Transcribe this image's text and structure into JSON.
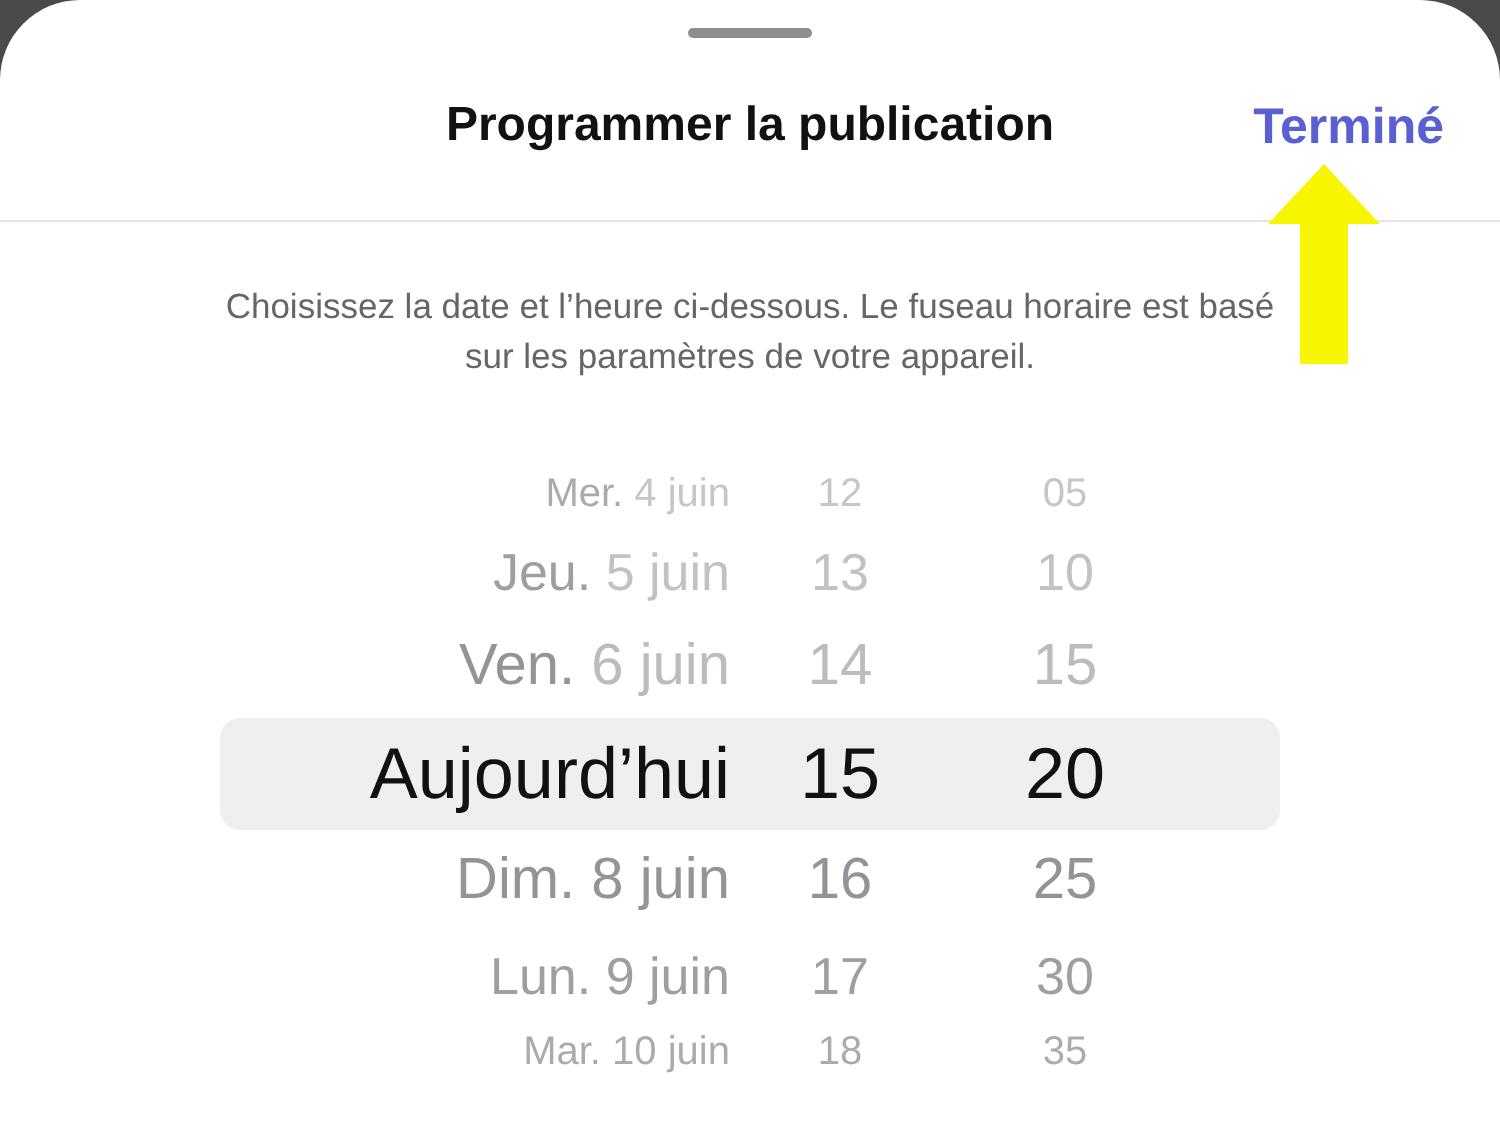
{
  "sheet": {
    "title": "Programmer la publication",
    "done_button": "Terminé",
    "description": "Choisissez la date et l’heure ci-dessous. Le fuseau horaire est basé sur les paramètres de votre appareil."
  },
  "picker_rows": [
    {
      "day_name": "Mer.",
      "day_date": "4 juin",
      "hour": "12",
      "minute": "05",
      "past": true,
      "selected": false
    },
    {
      "day_name": "Jeu.",
      "day_date": "5 juin",
      "hour": "13",
      "minute": "10",
      "past": true,
      "selected": false
    },
    {
      "day_name": "Ven.",
      "day_date": "6 juin",
      "hour": "14",
      "minute": "15",
      "past": true,
      "selected": false
    },
    {
      "day_name": "Aujourd’hui",
      "hour": "15",
      "minute": "20",
      "past": false,
      "selected": true
    },
    {
      "day_name": "Dim.",
      "day_date": "8 juin",
      "hour": "16",
      "minute": "25",
      "past": false,
      "selected": false
    },
    {
      "day_name": "Lun.",
      "day_date": "9 juin",
      "hour": "17",
      "minute": "30",
      "past": false,
      "selected": false
    },
    {
      "day_name": "Mar.",
      "day_date": "10 juin",
      "hour": "18",
      "minute": "35",
      "past": false,
      "selected": false
    }
  ],
  "annotation": {
    "kind": "arrow"
  }
}
